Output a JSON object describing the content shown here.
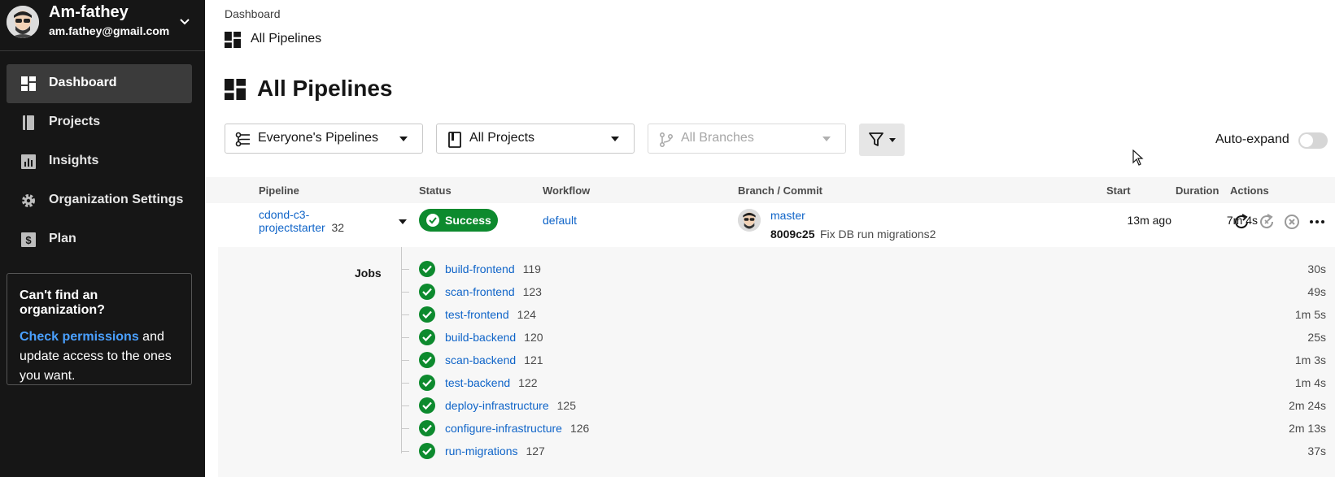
{
  "org": {
    "name": "Am-fathey",
    "email": "am.fathey@gmail.com"
  },
  "sidebar": {
    "items": [
      {
        "label": "Dashboard",
        "icon": "dashboard-icon",
        "active": true
      },
      {
        "label": "Projects",
        "icon": "projects-icon"
      },
      {
        "label": "Insights",
        "icon": "insights-icon"
      },
      {
        "label": "Organization Settings",
        "icon": "gear-icon"
      },
      {
        "label": "Plan",
        "icon": "plan-icon"
      }
    ],
    "help": {
      "question": "Can't find an organization?",
      "link": "Check permissions",
      "rest": " and update access to the ones you want."
    }
  },
  "breadcrumb": {
    "root": "Dashboard",
    "current": "All Pipelines"
  },
  "page_title": "All Pipelines",
  "filters": {
    "pipelines": "Everyone's Pipelines",
    "projects": "All Projects",
    "branches": "All Branches",
    "auto_expand_label": "Auto-expand"
  },
  "table": {
    "headers": {
      "pipeline": "Pipeline",
      "status": "Status",
      "workflow": "Workflow",
      "branch_commit": "Branch / Commit",
      "start": "Start",
      "duration": "Duration",
      "actions": "Actions"
    },
    "pipeline": {
      "project_line1": "cdond-c3-",
      "project_line2": "projectstarter",
      "number": "32",
      "status": "Success",
      "workflow": "default",
      "branch": "master",
      "commit_sha": "8009c25",
      "commit_message": "Fix DB run migrations2",
      "start": "13m ago",
      "duration": "7m 4s"
    },
    "jobs_label": "Jobs",
    "jobs": [
      {
        "name": "build-frontend",
        "number": "119",
        "duration": "30s"
      },
      {
        "name": "scan-frontend",
        "number": "123",
        "duration": "49s"
      },
      {
        "name": "test-frontend",
        "number": "124",
        "duration": "1m 5s"
      },
      {
        "name": "build-backend",
        "number": "120",
        "duration": "25s"
      },
      {
        "name": "scan-backend",
        "number": "121",
        "duration": "1m 3s"
      },
      {
        "name": "test-backend",
        "number": "122",
        "duration": "1m 4s"
      },
      {
        "name": "deploy-infrastructure",
        "number": "125",
        "duration": "2m 24s"
      },
      {
        "name": "configure-infrastructure",
        "number": "126",
        "duration": "2m 13s"
      },
      {
        "name": "run-migrations",
        "number": "127",
        "duration": "37s"
      }
    ]
  },
  "colors": {
    "success": "#0d8a2e",
    "link": "#0f64c8",
    "sidebar": "#161616"
  }
}
